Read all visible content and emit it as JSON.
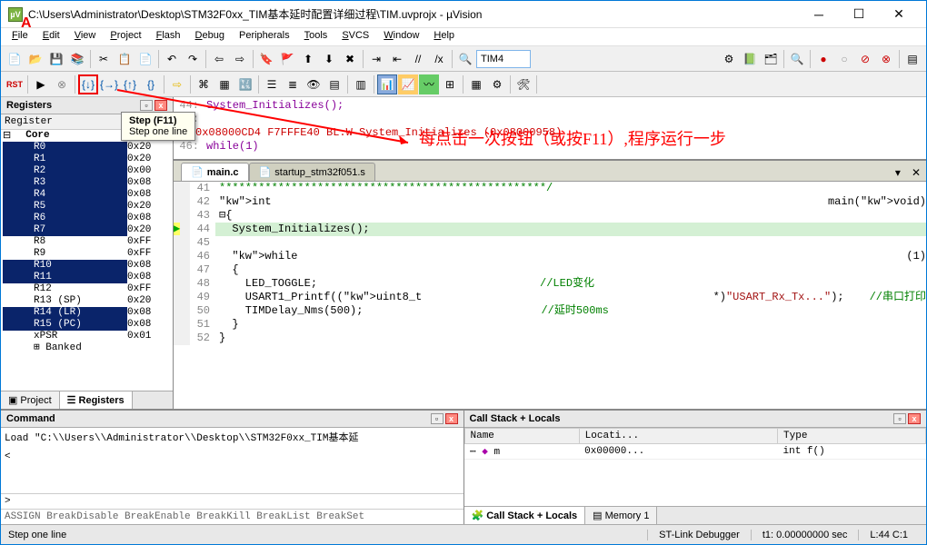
{
  "window": {
    "title": "C:\\Users\\Administrator\\Desktop\\STM32F0xx_TIM基本延时配置详细过程\\TIM.uvprojx - µVision"
  },
  "menu": [
    "File",
    "Edit",
    "View",
    "Project",
    "Flash",
    "Debug",
    "Peripherals",
    "Tools",
    "SVCS",
    "Window",
    "Help"
  ],
  "toolbar2_combo": "TIM4",
  "tooltip": {
    "title": "Step (F11)",
    "desc": "Step one line"
  },
  "annotation_text": "每点击一次按钮（或按F11）,程序运行一步",
  "registers": {
    "title": "Registers",
    "header": "Register",
    "core_label": "Core",
    "items": [
      {
        "n": "R0",
        "v": "0x20",
        "sel": true
      },
      {
        "n": "R1",
        "v": "0x20",
        "sel": true
      },
      {
        "n": "R2",
        "v": "0x00",
        "sel": true
      },
      {
        "n": "R3",
        "v": "0x08",
        "sel": true
      },
      {
        "n": "R4",
        "v": "0x08",
        "sel": true
      },
      {
        "n": "R5",
        "v": "0x20",
        "sel": true
      },
      {
        "n": "R6",
        "v": "0x08",
        "sel": true
      },
      {
        "n": "R7",
        "v": "0x20",
        "sel": true
      },
      {
        "n": "R8",
        "v": "0xFF",
        "sel": false
      },
      {
        "n": "R9",
        "v": "0xFF",
        "sel": false
      },
      {
        "n": "R10",
        "v": "0x08",
        "sel": true
      },
      {
        "n": "R11",
        "v": "0x08",
        "sel": true
      },
      {
        "n": "R12",
        "v": "0xFF",
        "sel": false
      },
      {
        "n": "R13 (SP)",
        "v": "0x20",
        "sel": false
      },
      {
        "n": "R14 (LR)",
        "v": "0x08",
        "sel": true
      },
      {
        "n": "R15 (PC)",
        "v": "0x08",
        "sel": true
      },
      {
        "n": "xPSR",
        "v": "0x01",
        "sel": false
      },
      {
        "n": "Banked",
        "v": "",
        "sel": false
      }
    ],
    "tabs": [
      {
        "l": "Project"
      },
      {
        "l": "Registers",
        "active": true
      }
    ]
  },
  "disasm": {
    "lines": [
      {
        "num": "44:",
        "txt": "    System_Initializes();",
        "cls": ""
      },
      {
        "num": "45:",
        "txt": "",
        "cls": ""
      },
      {
        "num": "",
        "txt": "0x08000CD4 F7FFFE40   BL.W     System_Initializes (0x08000958)",
        "arrow": true
      },
      {
        "num": "46:",
        "txt": "    while(1)",
        "cls": ""
      }
    ]
  },
  "editor_tabs": [
    {
      "l": "main.c",
      "active": true
    },
    {
      "l": "startup_stm32f051.s"
    }
  ],
  "editor": {
    "lines": [
      {
        "n": 41,
        "raw": "**************************************************/",
        "cmt": true
      },
      {
        "n": 42,
        "raw": "int main(void)"
      },
      {
        "n": 43,
        "raw": "{",
        "brace": true
      },
      {
        "n": 44,
        "raw": "  System_Initializes();",
        "cur": true,
        "arrow": true
      },
      {
        "n": 45,
        "raw": ""
      },
      {
        "n": 46,
        "raw": "  while(1)"
      },
      {
        "n": 47,
        "raw": "  {"
      },
      {
        "n": 48,
        "raw": "    LED_TOGGLE;",
        "c": "//LED变化"
      },
      {
        "n": 49,
        "raw": "    USART1_Printf((uint8_t*)\"USART_Rx_Tx...\");",
        "c": "//串口打印"
      },
      {
        "n": 50,
        "raw": "    TIMDelay_Nms(500);",
        "c": "//延时500ms"
      },
      {
        "n": 51,
        "raw": "  }"
      },
      {
        "n": 52,
        "raw": "}"
      }
    ]
  },
  "command": {
    "title": "Command",
    "content": "Load \"C:\\\\Users\\\\Administrator\\\\Desktop\\\\STM32F0xx_TIM基本延",
    "prompt": ">",
    "assign": "ASSIGN BreakDisable BreakEnable BreakKill BreakList BreakSet "
  },
  "callstack": {
    "title": "Call Stack + Locals",
    "cols": [
      "Name",
      "Locati...",
      "Type"
    ],
    "row": {
      "name": "m",
      "loc": "0x00000...",
      "type": "int f()"
    },
    "tabs": [
      {
        "l": "Call Stack + Locals",
        "active": true
      },
      {
        "l": "Memory 1"
      }
    ]
  },
  "status": {
    "left": "Step one line",
    "dbg": "ST-Link Debugger",
    "t1": "t1: 0.00000000 sec",
    "lc": "L:44 C:1"
  }
}
